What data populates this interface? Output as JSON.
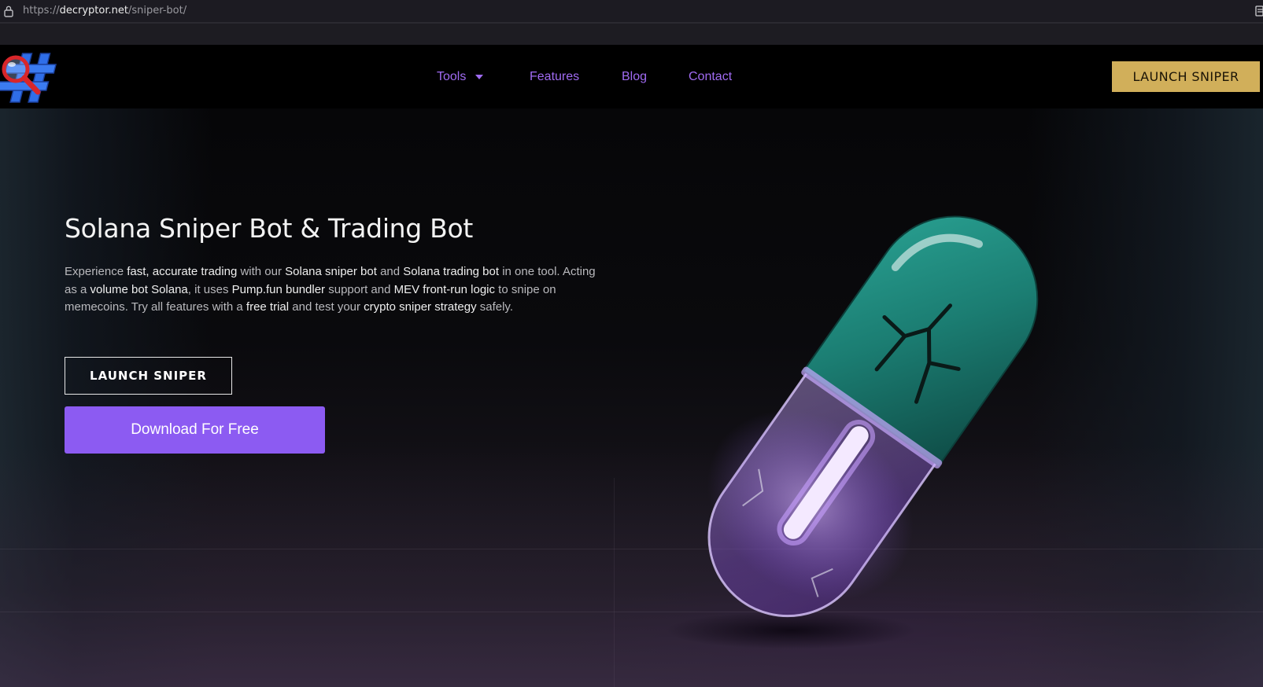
{
  "browser": {
    "url_prefix": "https://",
    "url_domain": "decryptor.net",
    "url_path": "/sniper-bot/"
  },
  "header": {
    "logo_icon": "hash-magnifier-logo-icon",
    "nav": {
      "tools": "Tools",
      "features": "Features",
      "blog": "Blog",
      "contact": "Contact"
    },
    "cta": "LAUNCH SNIPER"
  },
  "hero": {
    "title": "Solana Sniper Bot & Trading Bot",
    "paragraph": {
      "t1": "Experience ",
      "b1": "fast, accurate trading",
      "t2": " with our ",
      "b2": "Solana sniper bot",
      "t3": " and ",
      "b3": "Solana trading bot",
      "t4": " in one tool. Acting as a ",
      "b4": "volume bot Solana",
      "t5": ", it uses ",
      "b5": "Pump.fun bundler",
      "t6": " support and ",
      "b6": "MEV front-run logic",
      "t7": " to snipe on memecoins. Try all features with a ",
      "b7": "free trial",
      "t8": " and test your ",
      "b8": "crypto sniper strategy",
      "t9": " safely."
    },
    "launch_button": "LAUNCH SNIPER",
    "download_button": "Download For Free",
    "image": "cracked-pill-illustration"
  },
  "colors": {
    "nav_link": "#a06bf2",
    "header_cta_bg": "#d1af5a",
    "download_bg": "#8c5bf2",
    "pill_teal": "#1f8a7d",
    "pill_glow": "#c9a3ff"
  }
}
